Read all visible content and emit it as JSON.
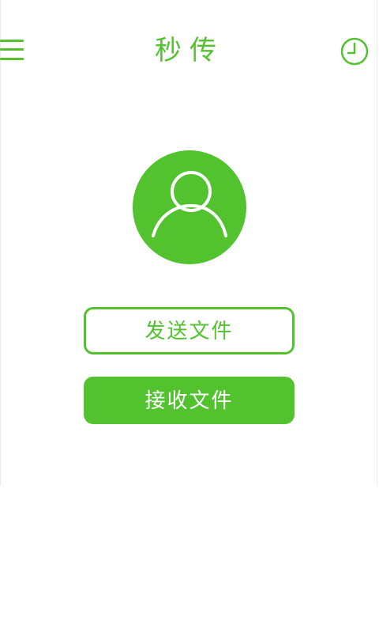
{
  "header": {
    "title": "秒传",
    "menu_icon": "hamburger-menu-icon",
    "history_icon": "clock-icon"
  },
  "main": {
    "avatar_icon": "user-avatar-icon",
    "send_button_label": "发送文件",
    "receive_button_label": "接收文件"
  },
  "colors": {
    "accent": "#52c22f",
    "background": "#ffffff"
  }
}
